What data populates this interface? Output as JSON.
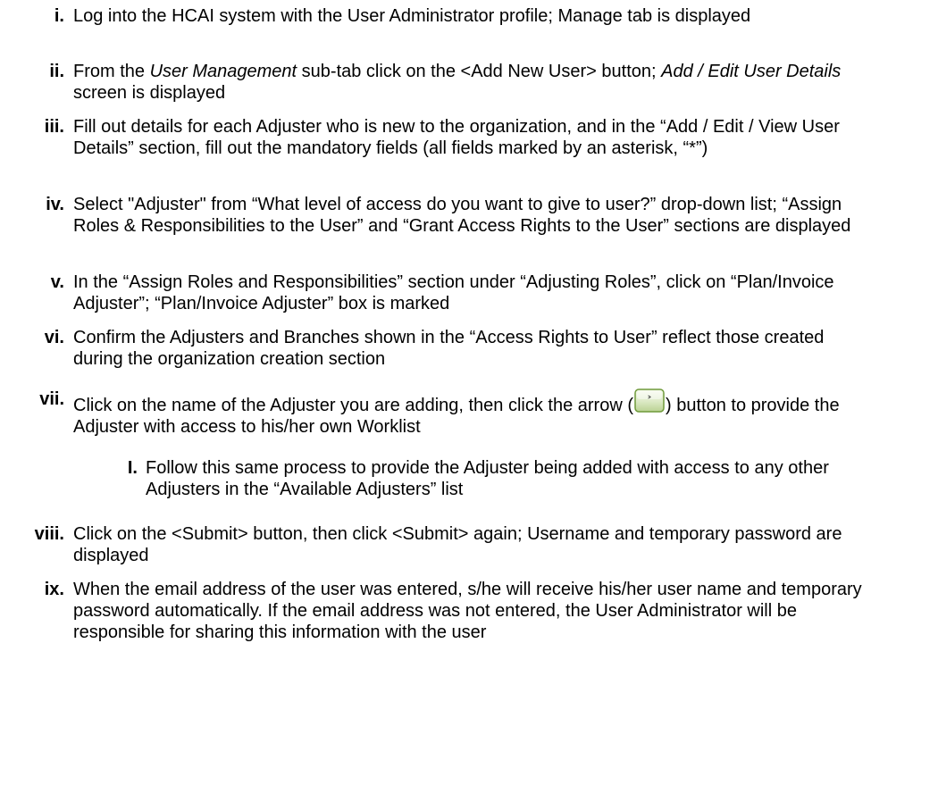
{
  "steps": [
    {
      "numeral": "i.",
      "text": "Log into the HCAI system with the User Administrator profile; Manage tab is displayed"
    },
    {
      "numeral": "ii.",
      "text_before": "From the ",
      "text_em1": "User Management",
      "text_mid": " sub-tab click on the <Add New User> button; ",
      "text_em2": "Add / Edit User Details",
      "text_after": " screen is displayed"
    },
    {
      "numeral": "iii.",
      "text": "Fill out details for each Adjuster who is new to the organization, and in the “Add / Edit / View User Details” section, fill out the mandatory fields (all fields marked by an asterisk, “*”)"
    },
    {
      "numeral": "iv.",
      "text": "Select \"Adjuster\" from “What level of access do you want to give to user?” drop-down list; “Assign Roles & Responsibilities to the User” and “Grant Access Rights to the User” sections are displayed"
    },
    {
      "numeral": "v.",
      "text": "In the “Assign Roles and Responsibilities” section under “Adjusting Roles”,  click on “Plan/Invoice Adjuster”; “Plan/Invoice Adjuster” box is marked"
    },
    {
      "numeral": "vi.",
      "text": "Confirm the Adjusters and Branches shown in the “Access Rights to User” reflect those created during the organization creation section"
    },
    {
      "numeral": "vii.",
      "text_before": "Click on the name of the Adjuster you are adding, then click the  arrow (",
      "text_after": ") button to provide the Adjuster with access to his/her own Worklist",
      "arrow_icon_glyph": "˃"
    },
    {
      "numeral": "I.",
      "text": "Follow this same process to provide the Adjuster being added with access to any other Adjusters in the “Available Adjusters” list"
    },
    {
      "numeral": "viii.",
      "text": "Click on the <Submit> button, then click <Submit> again; Username and temporary password are displayed"
    },
    {
      "numeral": "ix.",
      "text": "When the email address of the user was entered, s/he will receive his/her user name and temporary password automatically. If the email address was not entered, the User Administrator will be responsible for sharing this information with the user"
    }
  ]
}
